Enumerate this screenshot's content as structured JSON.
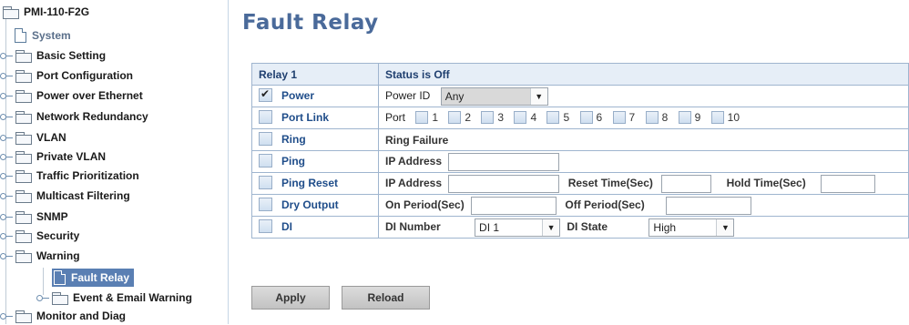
{
  "sidebar": {
    "root": "PMI-110-F2G",
    "items": [
      {
        "label": "System"
      },
      {
        "label": "Basic Setting"
      },
      {
        "label": "Port Configuration"
      },
      {
        "label": "Power over Ethernet"
      },
      {
        "label": "Network Redundancy"
      },
      {
        "label": "VLAN"
      },
      {
        "label": "Private VLAN"
      },
      {
        "label": "Traffic Prioritization"
      },
      {
        "label": "Multicast Filtering"
      },
      {
        "label": "SNMP"
      },
      {
        "label": "Security"
      },
      {
        "label": "Warning"
      },
      {
        "label": "Fault Relay"
      },
      {
        "label": "Event & Email Warning"
      },
      {
        "label": "Monitor and Diag"
      }
    ]
  },
  "page": {
    "title": "Fault Relay"
  },
  "table": {
    "header": {
      "relay": "Relay 1",
      "status": "Status is Off"
    },
    "power": {
      "label": "Power",
      "checked": true,
      "id_label": "Power ID",
      "id_value": "Any"
    },
    "port_link": {
      "label": "Port Link",
      "port_label": "Port",
      "ports": [
        "1",
        "2",
        "3",
        "4",
        "5",
        "6",
        "7",
        "8",
        "9",
        "10"
      ]
    },
    "ring": {
      "label": "Ring",
      "text": "Ring Failure"
    },
    "ping": {
      "label": "Ping",
      "ip_label": "IP Address",
      "ip_value": ""
    },
    "ping_reset": {
      "label": "Ping Reset",
      "ip_label": "IP Address",
      "reset_label": "Reset Time(Sec)",
      "hold_label": "Hold Time(Sec)"
    },
    "dry_output": {
      "label": "Dry Output",
      "on_label": "On Period(Sec)",
      "off_label": "Off Period(Sec)"
    },
    "di": {
      "label": "DI",
      "number_label": "DI Number",
      "number_value": "DI 1",
      "state_label": "DI State",
      "state_value": "High"
    }
  },
  "buttons": {
    "apply": "Apply",
    "reload": "Reload"
  },
  "colors": {
    "title": "#4a6a9a",
    "selected_bg": "#5a7fb3",
    "label_blue": "#1f4d8a",
    "table_border": "#9fb5cf"
  }
}
